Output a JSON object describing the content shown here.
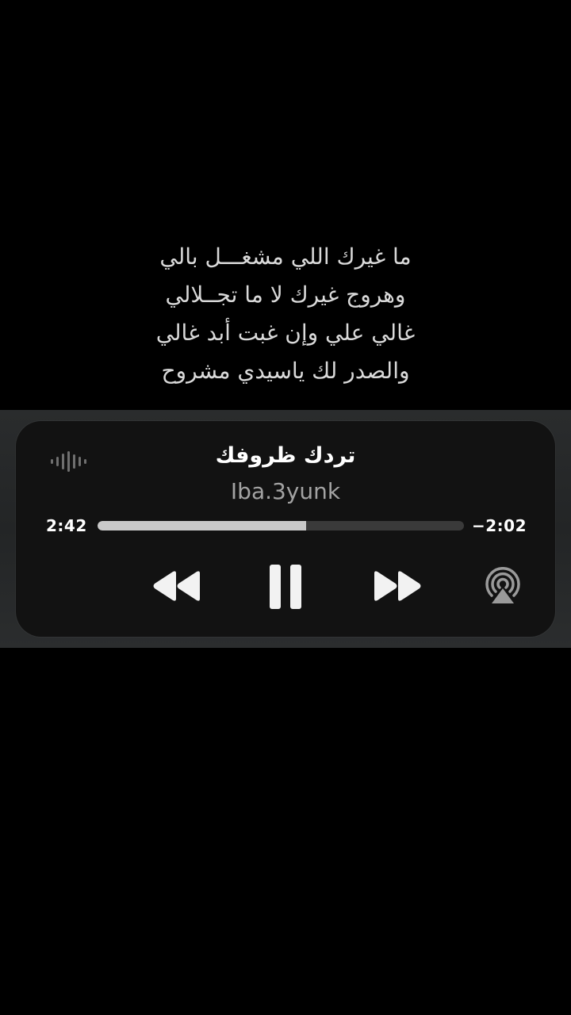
{
  "poem": {
    "lines": [
      "ما غيرك اللي مشغـــل بالي",
      "وهروج غيرك لا ما تجــلالي",
      "غالي علي وإن غبت أبد غالي",
      "والصدر لك ياسيدي مشروح"
    ]
  },
  "player": {
    "song_title": "تردك ظروفك",
    "artist": "Iba.3yunk",
    "elapsed": "2:42",
    "remaining": "−2:02",
    "progress": 0.57,
    "icons": [
      "waveform-icon",
      "rewind-icon",
      "pause-icon",
      "fast-forward-icon",
      "airplay-icon"
    ]
  }
}
